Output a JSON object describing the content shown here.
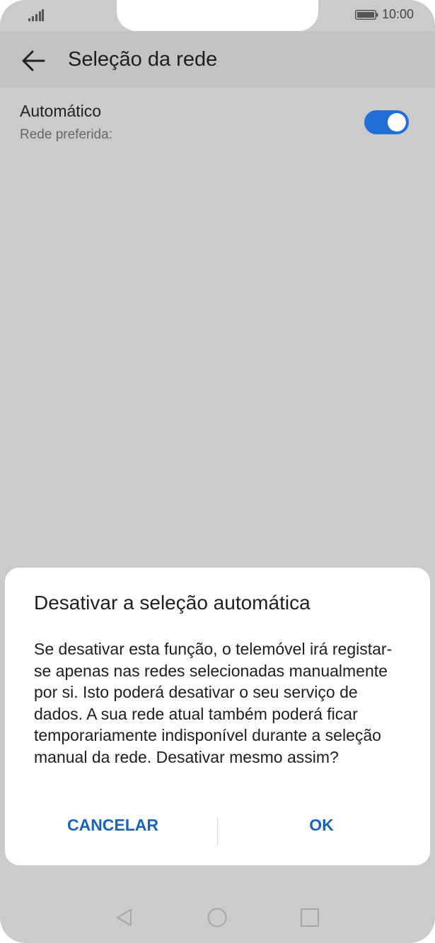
{
  "status_bar": {
    "time": "10:00"
  },
  "app_bar": {
    "title": "Seleção da rede"
  },
  "setting": {
    "title": "Automático",
    "subtitle": "Rede preferida:",
    "toggle_on": true,
    "toggle_color": "#1f6fd6"
  },
  "dialog": {
    "title": "Desativar a seleção automática",
    "body": "Se desativar esta função, o telemóvel irá registar-se apenas nas redes selecionadas manualmente por si. Isto poderá desativar o seu serviço de dados. A sua rede atual também poderá ficar temporariamente indisponível durante a seleção manual da rede. Desativar mesmo assim?",
    "cancel_label": "CANCELAR",
    "ok_label": "OK",
    "button_color": "#1a64b8"
  },
  "icons": {
    "signal": "signal-icon",
    "battery": "battery-icon",
    "back": "back-arrow-icon",
    "nav_back": "nav-back-icon",
    "nav_home": "nav-home-icon",
    "nav_recents": "nav-recents-icon"
  }
}
